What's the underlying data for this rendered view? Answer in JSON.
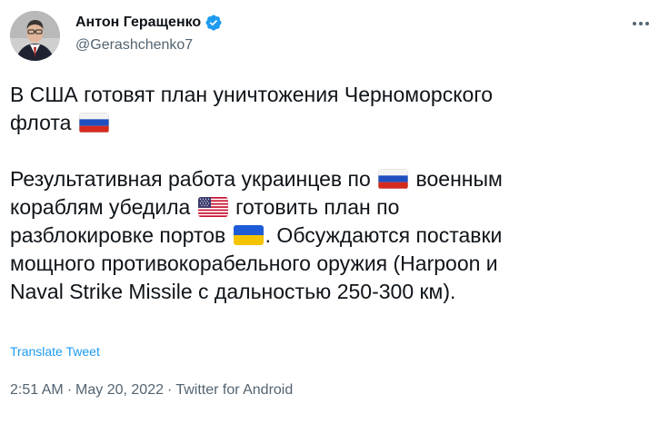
{
  "author": {
    "display_name": "Антон Геращенко",
    "handle": "@Gerashchenko7",
    "verified_icon": "verified-badge-icon",
    "verified_color": "#1d9bf0"
  },
  "more_icon": "more-dots-icon",
  "tweet": {
    "line1": "В США готовят план уничтожения Черноморского",
    "line2_text": "флота",
    "para2_a": "Результативная работа украинцев по",
    "para2_b": "военным",
    "para2_c": "кораблям убедила",
    "para2_d": "готовить план по",
    "para2_e": "разблокировке портов",
    "para2_f": ".  Обсуждаются поставки",
    "para2_g": "мощного противокорабельного оружия (Harpoon и",
    "para2_h": "Naval Strike Missile с дальностью 250-300 км).",
    "flags": [
      "russia-flag-icon",
      "usa-flag-icon",
      "ukraine-flag-icon"
    ]
  },
  "translate_label": "Translate Tweet",
  "meta": {
    "time": "2:51 AM",
    "date": "May 20, 2022",
    "source": "Twitter for Android",
    "separator": "·"
  },
  "colors": {
    "text": "#0f1419",
    "secondary": "#536471",
    "link": "#1d9bf0"
  }
}
